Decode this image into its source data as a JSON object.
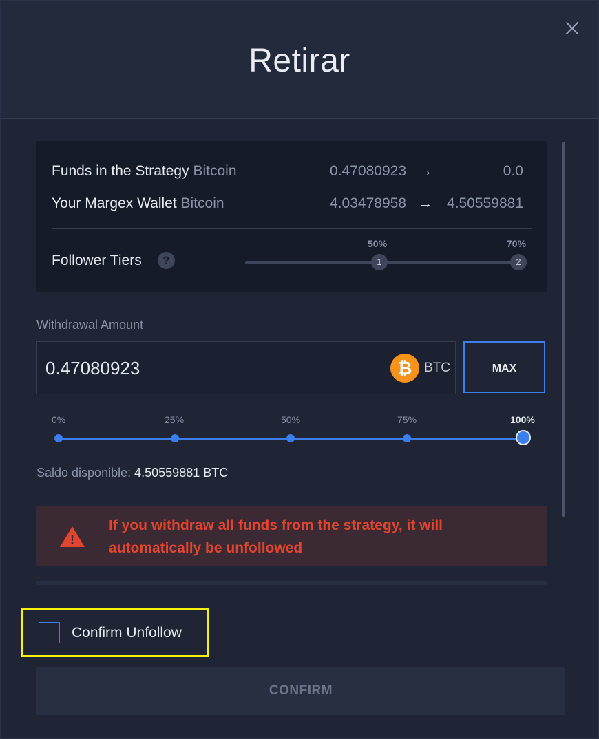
{
  "modal": {
    "title": "Retirar"
  },
  "summary": {
    "rows": [
      {
        "label": "Funds in the Strategy",
        "asset": "Bitcoin",
        "from": "0.47080923",
        "arrow": "→",
        "to": "0.0"
      },
      {
        "label": "Your Margex Wallet",
        "asset": "Bitcoin",
        "from": "4.03478958",
        "arrow": "→",
        "to": "4.50559881"
      }
    ],
    "tiers": {
      "label": "Follower Tiers",
      "help": "?",
      "points": [
        {
          "pct": "50%",
          "num": "1"
        },
        {
          "pct": "70%",
          "num": "2"
        }
      ]
    }
  },
  "withdraw": {
    "label": "Withdrawal Amount",
    "value": "0.47080923",
    "currency": "BTC",
    "currency_icon": "bitcoin-icon",
    "currency_symbol": "₿",
    "max_label": "MAX",
    "slider": {
      "marks": [
        "0%",
        "25%",
        "50%",
        "75%",
        "100%"
      ],
      "value_fraction": 1.0
    },
    "available_label": "Saldo disponible:",
    "available_value": "4.50559881 BTC"
  },
  "warning": {
    "icon": "warning-icon",
    "text": "If you withdraw all funds from the strategy, it will automatically be unfollowed"
  },
  "confirm_unfollow": {
    "label": "Confirm Unfollow",
    "checked": false
  },
  "confirm_button": {
    "label": "CONFIRM"
  },
  "colors": {
    "accent": "#3d7eef",
    "warning": "#e0452f",
    "bitcoin": "#f7931a",
    "highlight": "#f6f20a"
  }
}
